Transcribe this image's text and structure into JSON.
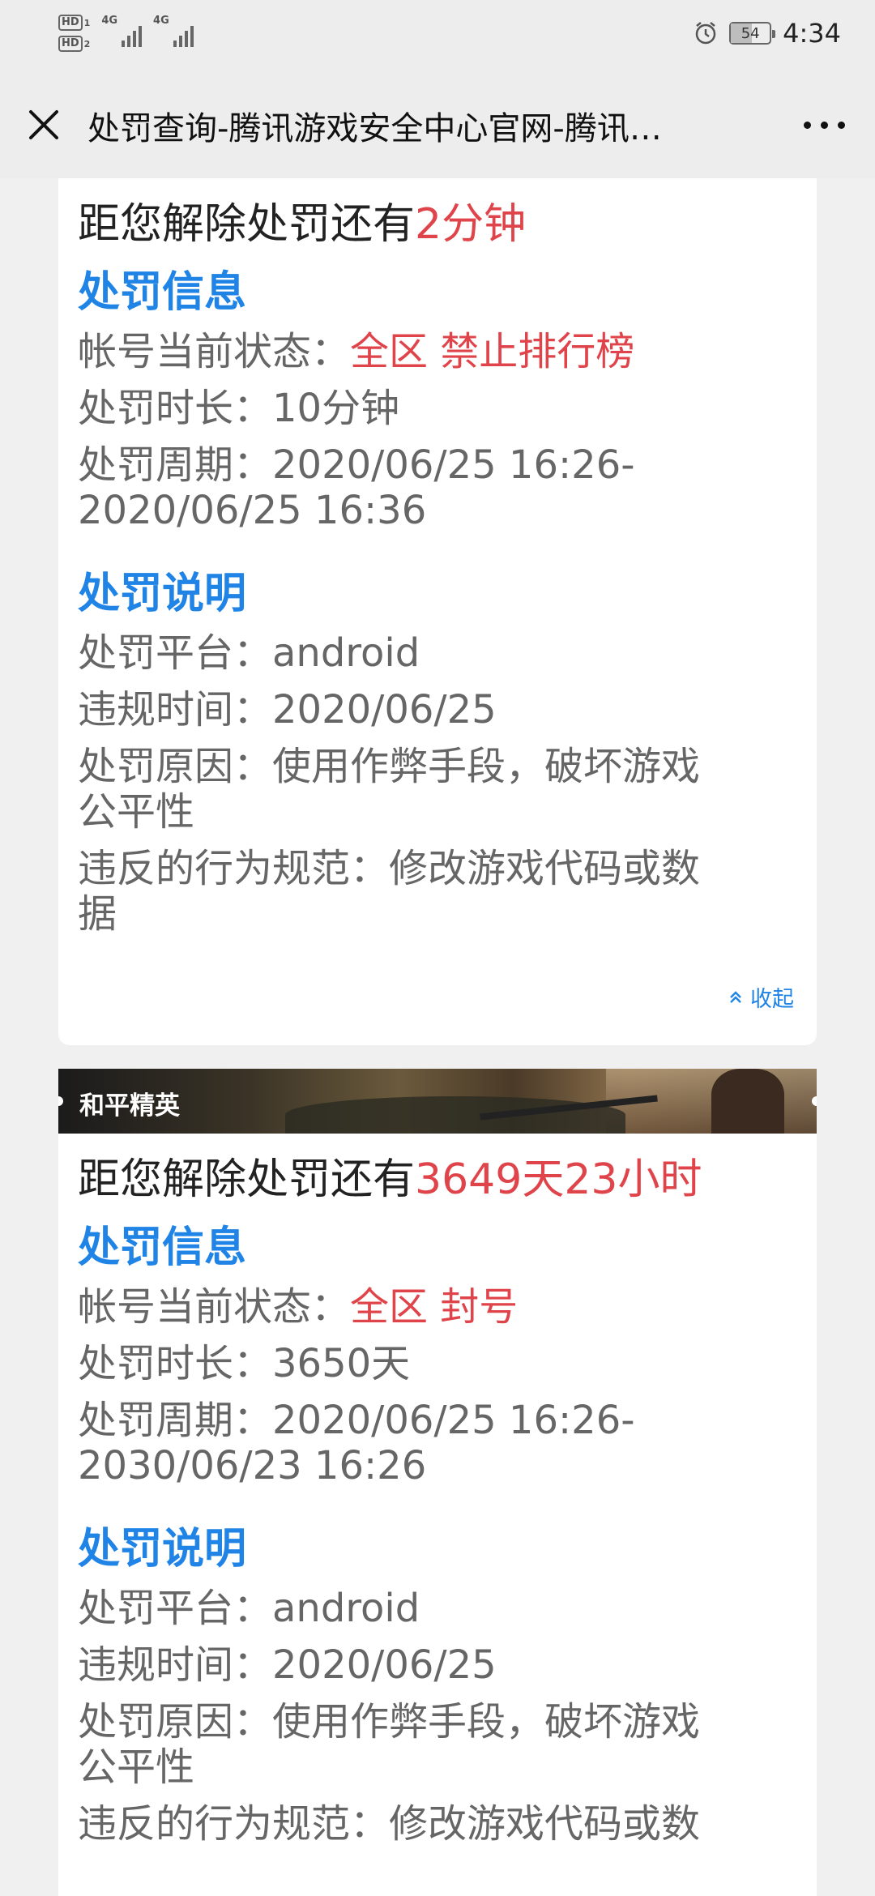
{
  "status_bar": {
    "hd1": "HD",
    "hd1_num": "1",
    "hd2": "HD",
    "hd2_num": "2",
    "net1": "4G",
    "net2": "4G",
    "battery": "54",
    "time": "4:34",
    "icons": [
      "alarm-icon",
      "battery-icon",
      "signal-icon"
    ]
  },
  "nav": {
    "title": "处罚查询-腾讯游戏安全中心官网-腾讯…",
    "icons": [
      "close-icon",
      "more-icon"
    ]
  },
  "cards": [
    {
      "countdown_prefix": "距您解除处罚还有",
      "countdown_value": "2分钟",
      "info_heading": "处罚信息",
      "status_label": "帐号当前状态：",
      "status_value": "全区 禁止排行榜",
      "duration_label": "处罚时长：",
      "duration_value": "10分钟",
      "period_label": "处罚周期：",
      "period_start": "2020/06/25 16:26-",
      "period_end": "2020/06/25 16:36",
      "desc_heading": "处罚说明",
      "platform_label": "处罚平台：",
      "platform_value": "android",
      "violation_time_label": "违规时间：",
      "violation_time_value": "2020/06/25",
      "reason_label": "处罚原因：",
      "reason_value_line1": "使用作弊手段，破坏游戏",
      "reason_value_line2": "公平性",
      "rule_label": "违反的行为规范：",
      "rule_value_line1": "修改游戏代码或数",
      "rule_value_line2": "据",
      "collapse_label": "收起"
    },
    {
      "game_name": "和平精英",
      "countdown_prefix": "距您解除处罚还有",
      "countdown_value": "3649天23小时",
      "info_heading": "处罚信息",
      "status_label": "帐号当前状态：",
      "status_value": "全区 封号",
      "duration_label": "处罚时长：",
      "duration_value": "3650天",
      "period_label": "处罚周期：",
      "period_start": "2020/06/25 16:26-",
      "period_end": "2030/06/23 16:26",
      "desc_heading": "处罚说明",
      "platform_label": "处罚平台：",
      "platform_value": "android",
      "violation_time_label": "违规时间：",
      "violation_time_value": "2020/06/25",
      "reason_label": "处罚原因：",
      "reason_value_line1": "使用作弊手段，破坏游戏",
      "reason_value_line2": "公平性",
      "rule_label": "违反的行为规范：",
      "rule_value_line1": "修改游戏代码或数"
    }
  ],
  "colors": {
    "accent_blue": "#1f84e6",
    "alert_red": "#e0444b",
    "background": "#ededed"
  }
}
